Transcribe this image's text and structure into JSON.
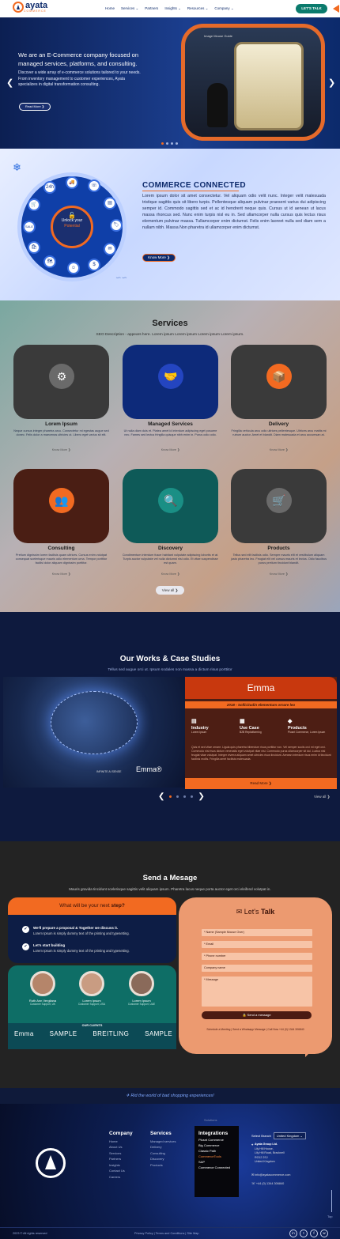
{
  "header": {
    "logo_name": "ayata",
    "logo_sub": "COMMERCE",
    "nav": [
      "Home",
      "Services ⌄",
      "Partners",
      "Insights ⌄",
      "Resources ⌄",
      "Company ⌄"
    ],
    "cta": "LET'S TALK"
  },
  "hero": {
    "title": "We are an E-Commerce company focused on managed services, platforms, and consulting.",
    "text": "Discover a wide array of e-commerce solutions tailored to your needs. From inventory management to customer experiences, Ayata specializes in digital transformation consulting.",
    "button": "Read More ❯",
    "image_label": "Image Mouse Guide",
    "prev": "❮",
    "next": "❯"
  },
  "commerce": {
    "title": "COMMERCE CONNECTED",
    "text": "Lorem ipsum dolor sit amet consectetur. Vel aliquam odio velit nunc. Integer velit malesuada tristique sagittis quis sit libero turpis. Pellentesque aliquam pulvinar praesent varius dui adipiscing semper id. Commodo sagittis sed et ac id hendrerit neque quis. Cursus ut id aenean ut lacus massa rhoncus sed. Nunc enim turpis nisl eu in. Sed ullamcorper nulla cursus quis lectus risus elementum pulvinar massa. Tullamcorper enim dictumst. Felis enim laoreet nulla sed diam sem a nullam nibh. Massa Non pharetra id ullamcorper enim dictumst.",
    "button": "Know More ❯",
    "wheel_center_line1": "Unlock your",
    "wheel_center_line2": "Potential",
    "wheel_icons": [
      "24h",
      "🚚",
      "☏",
      "🛒",
      "▤",
      "🏷",
      "✉",
      "☺",
      "🗺",
      "$",
      "SALE",
      "🛍"
    ]
  },
  "services": {
    "title": "Services",
    "description": "SEO Description - appears here. Lorem ipsum Lorem ipsum Lorem ipsum Lorem ipsum.",
    "cards": [
      {
        "title": "Lorem Ipsum",
        "text": "Neque cursus integer pharetra arcu. Consectetur mi egestas augue sed donec. Felis dolor a maecenas ultricies ut. Libero eget varius sit elit.",
        "more": "Know More ❯",
        "icon": "⚙",
        "bg": "#3a3a3a",
        "iconbg": "#6a6a6a"
      },
      {
        "title": "Managed Services",
        "text": "Ut nulla diam duis et. Platea amet id interdum adipiscing eget posuere nec. Fames sed lectus fringilla quisque nibh enim in. Purus odio odio.",
        "more": "Know More ❯",
        "icon": "🤝",
        "bg": "#0d2a7a",
        "iconbg": "#2445c0"
      },
      {
        "title": "Delivery",
        "text": "Fringilla vehicula arcu odio ultrices pellentesque. Ultrices arcu mattis mi rutrum auctor. Amet et blandit. Diam malesuada et arcu accumsan at.",
        "more": "Know More ❯",
        "icon": "📦",
        "bg": "#3a3a3a",
        "iconbg": "#f26a21"
      },
      {
        "title": "Consulting",
        "text": "Pretium dignissim lorem facilisis quam ultrices. Cursus enim volutpat consequat scelerisque mauris odio elementum urna. Tempor porttitor facilisi dolor aliquam dignissim porttitor.",
        "more": "Know More ❯",
        "icon": "👥",
        "bg": "#4a1e14",
        "iconbg": "#f26a21"
      },
      {
        "title": "Discovery",
        "text": "Condimentum interdum fusce habitant vulputate adipiscing lobortis et at. Turpis auctor vulputate vel nulla dictumst nisl odio. Et vitae suspendisse est quam.",
        "more": "Know More ❯",
        "icon": "🔍",
        "bg": "#0e5a58",
        "iconbg": "#1a8f85"
      },
      {
        "title": "Products",
        "text": "Tellus sed elit facilisis odio. Semper mauris elit et vestibulum aliquam justo pharetra leo. Feugiat elit vel cursus mauris et lectus. Odio faucibus purus pretium tincidunt blandit.",
        "more": "Know More ❯",
        "icon": "🛒",
        "bg": "#3a3a3a",
        "iconbg": "#6a6a6a"
      }
    ],
    "view_all": "View all ❯"
  },
  "cases": {
    "title": "Our Works & Case Studies",
    "description": "Tellus sed augue orci ut. Ipsum sodales non massa a dictum risus porttitor",
    "brand": "Emma",
    "image_brand": "Emma®",
    "image_tag": "INFINITE AI SENSE",
    "headline": "2018 - Sollicitudin elementum ornare leo",
    "columns": [
      {
        "label": "Industry",
        "value": "Lorem Ipsum",
        "icon": "▤"
      },
      {
        "label": "Use Case",
        "value": "B2B Replatforming",
        "icon": "▦"
      },
      {
        "label": "Products",
        "value": "Plusnt Commerce, Lorem Ipsum",
        "icon": "◆"
      }
    ],
    "text": "Quis et sed vitae ornare. Ligula quis pharetra bibendum risus porttitor non. Vel semper sociis orci mi eget orci. Commodo nisl risus dictum venenatis eget volutpat vitae nisi. Commodo purus ullamcorper sit dui. Luctus nisl feugiat vitae volutpat. Integer viverra aliquam amet ultricies risus tincidunt. Aenean interdum risus enim id tincidunt facilisis mollis. Fringilla amet facilisis malesuada.",
    "read_more": "Read More ❯",
    "prev": "❮",
    "next": "❯",
    "view_all": "View all ❯"
  },
  "send": {
    "title": "Send a Mesage",
    "description": "Mauris gravida tincidunt scelerisque sagittis velit aliquam ipsum. Pharetra lacus neque porta auctor eget orci eleifend volutpat in.",
    "next_step_pre": "What will be your next ",
    "next_step_bold": "step?",
    "steps": [
      {
        "title": "We'll prepare a proposal & Together we discuss it.",
        "text": "Lorem Ipsum is simply dummy text of the printing and typesetting."
      },
      {
        "title": "Let's start building",
        "text": "Lorem Ipsum is simply dummy text of the printing and typesetting."
      }
    ],
    "members": [
      {
        "name": "Ruth Ann Vergilana",
        "role": "Customer Support, UK"
      },
      {
        "name": "Lorem Ipsum",
        "role": "Customer Support, USA"
      },
      {
        "name": "Lorem Ipsum",
        "role": "Customer Support, UAE"
      }
    ],
    "clients_title": "OUR CLIENTS",
    "clients": [
      "Emma",
      "SAMPLE",
      "BREITLING",
      "SAMPLE"
    ],
    "form_title_pre": "Let's ",
    "form_title_bold": "Talk",
    "fields": [
      "* Name (Sample Mouse Over)",
      "* Email",
      "* Phone number",
      "Company name",
      "* Message"
    ],
    "send_label": "🔒  Send a message",
    "form_footer": "Schedule a Meeting  |  Send a Whatsapp Message  |  Call Now +44 (0) 1344 306840"
  },
  "tagline": "Rid the world of bad shopping experiences!",
  "footer": {
    "company_title": "Company",
    "company_links": [
      "Home",
      "About Us",
      "Services",
      "Partners",
      "Insights",
      "Contact Us",
      "Careers"
    ],
    "services_title": "Services",
    "services_links": [
      "Managed services",
      "Delivery",
      "Consulting",
      "Discovery",
      "Products"
    ],
    "integrations_label": "Solutions",
    "integrations_title": "Integrations",
    "integrations_links": [
      "Plusnt Commerce",
      "Big Commerce",
      "Classic Path",
      "CommerceTools",
      "SAP",
      "Commerce Connected"
    ],
    "branch_label": "Select Branch",
    "branch_value": "United Kingdom ⌄",
    "address_name": "Ayata Group Ltd.",
    "address_lines": [
      "Lily Hill House,",
      "Lily Hill Road, Bracknell",
      "RG12 2SJ",
      "United Kingdom"
    ],
    "email": "info@ayatacommerce.com",
    "phone": "+44 (0) 1344 306840",
    "top": "Top",
    "copyright": "2023 © All rights reserved",
    "legal": "Privacy Policy  |  Terms and Conditions  |  Site Map",
    "social": [
      "in",
      "t",
      "f",
      "w"
    ]
  }
}
